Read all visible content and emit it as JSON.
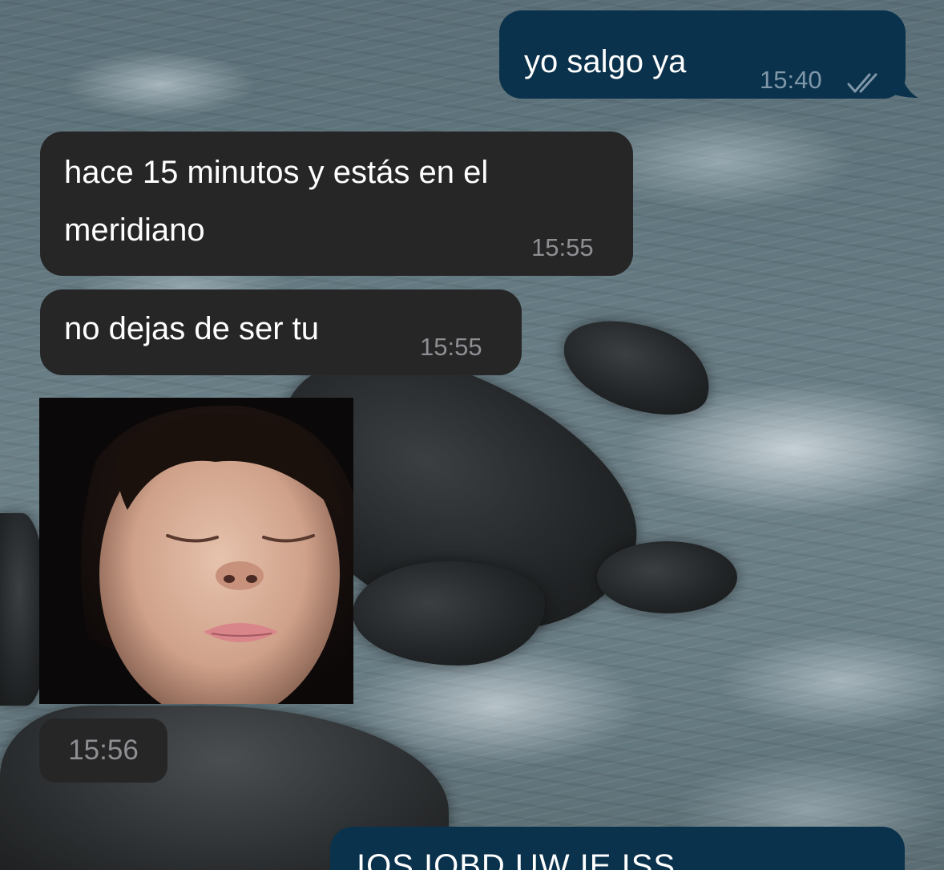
{
  "chat": {
    "messages": [
      {
        "direction": "outgoing",
        "text": "yo salgo ya",
        "time": "15:40",
        "status_icon": "double-check-icon"
      },
      {
        "direction": "incoming",
        "text_line1": "hace 15 minutos y estás en el",
        "text_line2": "meridiano",
        "time": "15:55"
      },
      {
        "direction": "incoming",
        "text": "no dejas de ser tu",
        "time": "15:55"
      },
      {
        "direction": "incoming",
        "type": "photo",
        "time": "15:56"
      },
      {
        "direction": "outgoing",
        "text": "IOS IOBD UW IE ISS"
      }
    ]
  },
  "colors": {
    "incoming_bubble": "#262627",
    "outgoing_bubble": "#0a324c",
    "message_text": "#ffffff",
    "incoming_time": "#8f8f93",
    "outgoing_time": "#7f97a8"
  }
}
